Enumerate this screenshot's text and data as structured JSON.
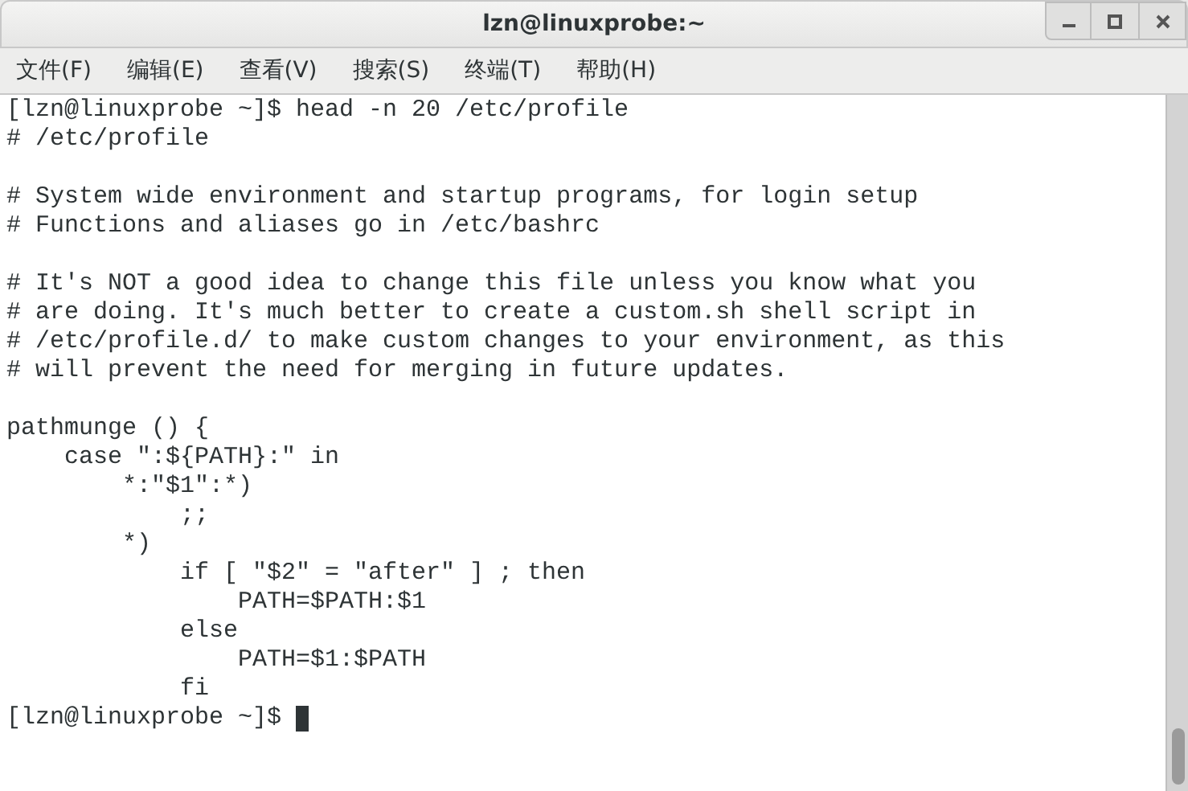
{
  "window": {
    "title": "lzn@linuxprobe:~"
  },
  "menu": [
    "文件(F)",
    "编辑(E)",
    "查看(V)",
    "搜索(S)",
    "终端(T)",
    "帮助(H)"
  ],
  "terminal": {
    "lines": [
      {
        "kind": "text",
        "text": "[lzn@linuxprobe ~]$ head -n 20 /etc/profile"
      },
      {
        "kind": "text",
        "text": "# /etc/profile"
      },
      {
        "kind": "blank"
      },
      {
        "kind": "text",
        "text": "# System wide environment and startup programs, for login setup"
      },
      {
        "kind": "text",
        "text": "# Functions and aliases go in /etc/bashrc"
      },
      {
        "kind": "blank"
      },
      {
        "kind": "text",
        "text": "# It's NOT a good idea to change this file unless you know what you"
      },
      {
        "kind": "text",
        "text": "# are doing. It's much better to create a custom.sh shell script in"
      },
      {
        "kind": "text",
        "text": "# /etc/profile.d/ to make custom changes to your environment, as this"
      },
      {
        "kind": "text",
        "text": "# will prevent the need for merging in future updates."
      },
      {
        "kind": "blank"
      },
      {
        "kind": "text",
        "text": "pathmunge () {"
      },
      {
        "kind": "text",
        "text": "    case \":${PATH}:\" in"
      },
      {
        "kind": "text",
        "text": "        *:\"$1\":*)"
      },
      {
        "kind": "text",
        "text": "            ;;"
      },
      {
        "kind": "text",
        "text": "        *)"
      },
      {
        "kind": "text",
        "text": "            if [ \"$2\" = \"after\" ] ; then"
      },
      {
        "kind": "text",
        "text": "                PATH=$PATH:$1"
      },
      {
        "kind": "text",
        "text": "            else"
      },
      {
        "kind": "text",
        "text": "                PATH=$1:$PATH"
      },
      {
        "kind": "text",
        "text": "            fi"
      },
      {
        "kind": "prompt",
        "text": "[lzn@linuxprobe ~]$ ",
        "cursor": true
      }
    ]
  }
}
